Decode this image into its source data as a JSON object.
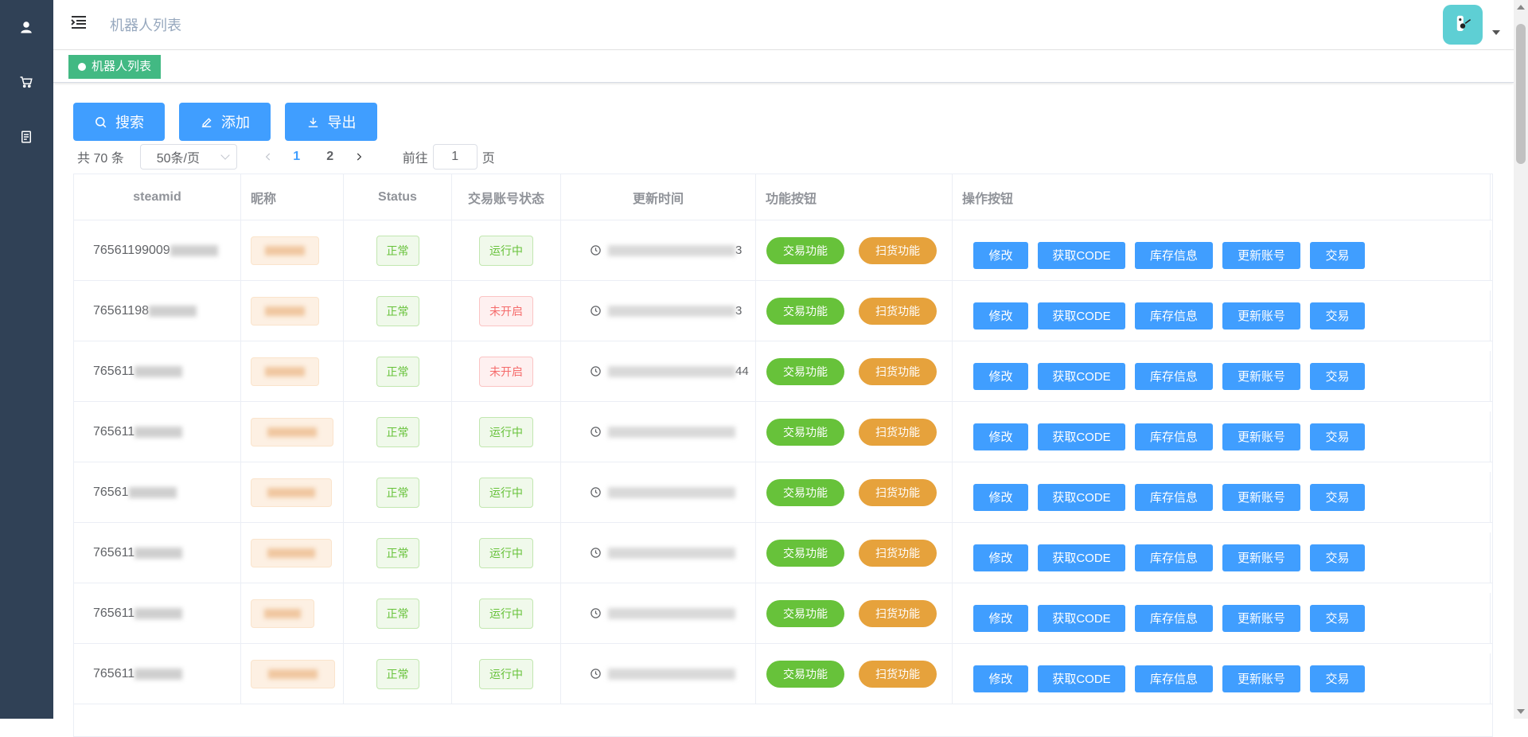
{
  "sidebar": {
    "items": [
      {
        "icon": "user-icon"
      },
      {
        "icon": "cart-icon"
      },
      {
        "icon": "document-icon"
      }
    ]
  },
  "header": {
    "title": "机器人列表",
    "avatar_icon": "robot-avatar-icon"
  },
  "tagsview": {
    "active_tag": "机器人列表"
  },
  "toolbar": {
    "search_label": "搜索",
    "add_label": "添加",
    "export_label": "导出"
  },
  "pagination": {
    "total": "共 70 条",
    "page_size": "50条/页",
    "pages": [
      "1",
      "2"
    ],
    "current_page": "1",
    "goto_label": "前往",
    "goto_value": "1",
    "page_suffix": "页"
  },
  "table": {
    "columns": [
      "steamid",
      "昵称",
      "Status",
      "交易账号状态",
      "更新时间",
      "功能按钮",
      "操作按钮"
    ],
    "rows": [
      {
        "steamid": "76561199009",
        "status": "正常",
        "trade_status": "运行中",
        "time_tail": "3"
      },
      {
        "steamid": "76561198",
        "status": "正常",
        "trade_status": "未开启",
        "time_tail": "3"
      },
      {
        "steamid": "765611",
        "status": "正常",
        "trade_status": "未开启",
        "time_tail": "44"
      },
      {
        "steamid": "765611",
        "status": "正常",
        "trade_status": "运行中",
        "time_tail": ""
      },
      {
        "steamid": "76561",
        "status": "正常",
        "trade_status": "运行中",
        "time_tail": ""
      },
      {
        "steamid": "765611",
        "status": "正常",
        "trade_status": "运行中",
        "time_tail": ""
      },
      {
        "steamid": "765611",
        "status": "正常",
        "trade_status": "运行中",
        "time_tail": ""
      },
      {
        "steamid": "765611",
        "status": "正常",
        "trade_status": "运行中",
        "time_tail": ""
      }
    ],
    "feature_buttons": [
      "交易功能",
      "扫货功能"
    ],
    "op_buttons": [
      "修改",
      "获取CODE",
      "库存信息",
      "更新账号",
      "交易"
    ]
  },
  "colors": {
    "sidebar_bg": "#304156",
    "primary": "#409eff",
    "success": "#67c23a",
    "warning": "#e6a23c",
    "danger": "#f56c6c",
    "tag_active": "#42b983"
  }
}
